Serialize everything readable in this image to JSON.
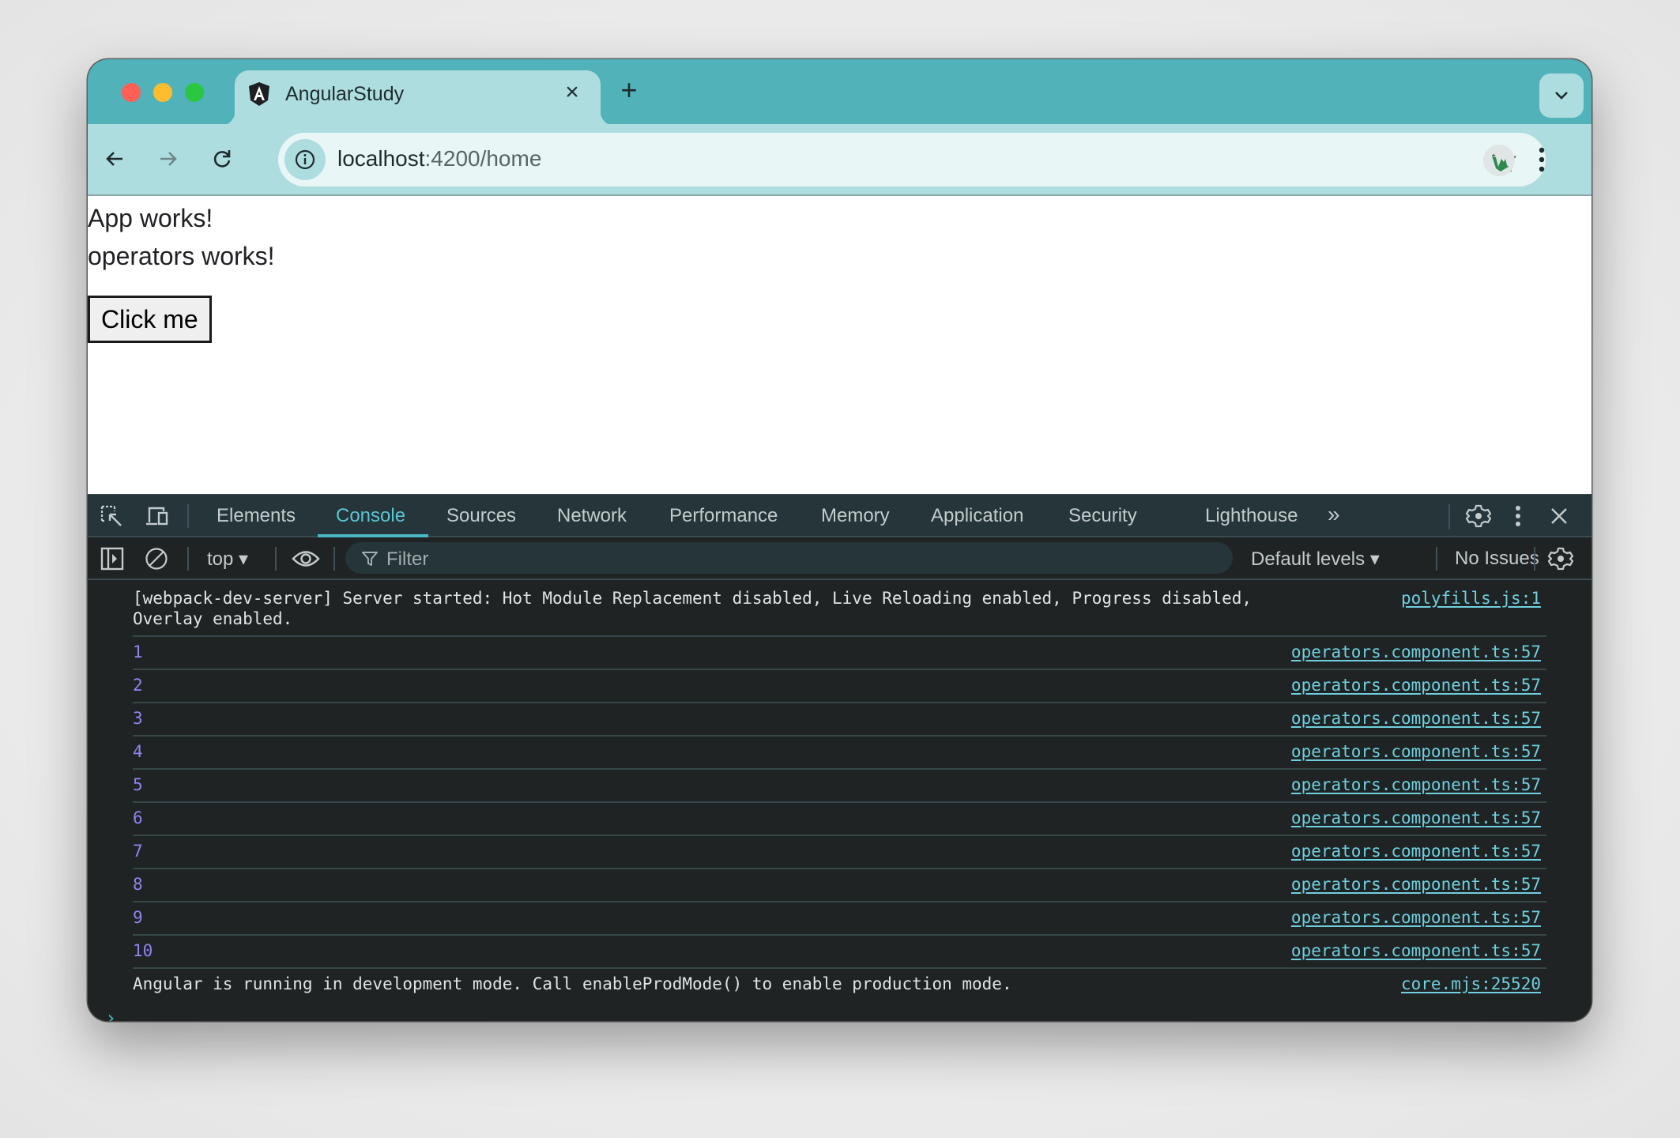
{
  "browser": {
    "tab": {
      "title": "AngularStudy",
      "close_glyph": "×",
      "favicon": "angular-logo-icon"
    },
    "new_tab_glyph": "+",
    "address": {
      "host": "localhost",
      "path": ":4200/home"
    }
  },
  "page": {
    "lines": [
      "App works!",
      "operators works!"
    ],
    "button_label": "Click me"
  },
  "devtools": {
    "tabs": [
      {
        "label": "Elements",
        "active": false
      },
      {
        "label": "Console",
        "active": true
      },
      {
        "label": "Sources",
        "active": false
      },
      {
        "label": "Network",
        "active": false
      },
      {
        "label": "Performance",
        "active": false
      },
      {
        "label": "Memory",
        "active": false
      },
      {
        "label": "Application",
        "active": false
      },
      {
        "label": "Security",
        "active": false
      },
      {
        "label": "Lighthouse",
        "active": false
      }
    ],
    "more_tabs_glyph": "»",
    "toolbar": {
      "context": "top ▾",
      "filter_placeholder": "Filter",
      "levels": "Default levels ▾",
      "issues": "No Issues"
    },
    "console": {
      "messages": [
        {
          "text": "[webpack-dev-server] Server started: Hot Module Replacement disabled, Live Reloading enabled, Progress disabled,\nOverlay enabled.",
          "source": "polyfills.js:1",
          "type": "log"
        },
        {
          "text": "1",
          "source": "operators.component.ts:57",
          "type": "number"
        },
        {
          "text": "2",
          "source": "operators.component.ts:57",
          "type": "number"
        },
        {
          "text": "3",
          "source": "operators.component.ts:57",
          "type": "number"
        },
        {
          "text": "4",
          "source": "operators.component.ts:57",
          "type": "number"
        },
        {
          "text": "5",
          "source": "operators.component.ts:57",
          "type": "number"
        },
        {
          "text": "6",
          "source": "operators.component.ts:57",
          "type": "number"
        },
        {
          "text": "7",
          "source": "operators.component.ts:57",
          "type": "number"
        },
        {
          "text": "8",
          "source": "operators.component.ts:57",
          "type": "number"
        },
        {
          "text": "9",
          "source": "operators.component.ts:57",
          "type": "number"
        },
        {
          "text": "10",
          "source": "operators.component.ts:57",
          "type": "number"
        },
        {
          "text": "Angular is running in development mode. Call enableProdMode() to enable production mode.",
          "source": "core.mjs:25520",
          "type": "log"
        }
      ],
      "prompt_glyph": "›"
    }
  },
  "colors": {
    "titlebar": "#52b2ba",
    "toolbar": "#aedde0",
    "devtools_accent": "#4bb6c4",
    "console_number": "#9085f0",
    "console_link": "#6fd0df"
  }
}
